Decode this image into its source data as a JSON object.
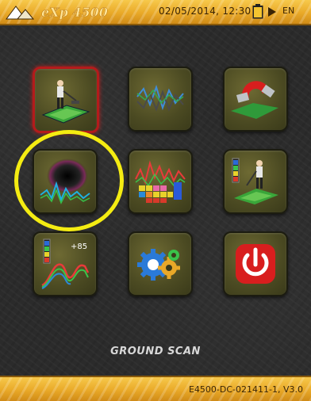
{
  "header": {
    "logo_text": "eXp 4500",
    "datetime": "02/05/2014, 12:30",
    "language": "EN"
  },
  "menu": {
    "items": [
      {
        "id": "ground-scan",
        "icon": "ground-scan-icon",
        "selected": true
      },
      {
        "id": "signal-tracking",
        "icon": "signal-tracking-icon",
        "selected": false
      },
      {
        "id": "magnetometer",
        "icon": "magnet-icon",
        "selected": false
      },
      {
        "id": "cavity-detection",
        "icon": "cavity-icon",
        "selected": false
      },
      {
        "id": "mineral-discrimination",
        "icon": "periodic-table-icon",
        "selected": false
      },
      {
        "id": "automatic-scan",
        "icon": "automatic-scan-icon",
        "selected": false
      },
      {
        "id": "depth-measurement",
        "icon": "depth-meter-icon",
        "selected": false,
        "value_label": "+85"
      },
      {
        "id": "settings",
        "icon": "gears-icon",
        "selected": false
      },
      {
        "id": "power",
        "icon": "power-icon",
        "selected": false
      }
    ]
  },
  "status": {
    "selected_mode": "GROUND SCAN"
  },
  "footer": {
    "version": "E4500-DC-021411-1, V3.0"
  },
  "colors": {
    "bar_gold": "#e9a928",
    "highlight_ring": "#f4ec12",
    "selection_border": "#b31b1b"
  }
}
